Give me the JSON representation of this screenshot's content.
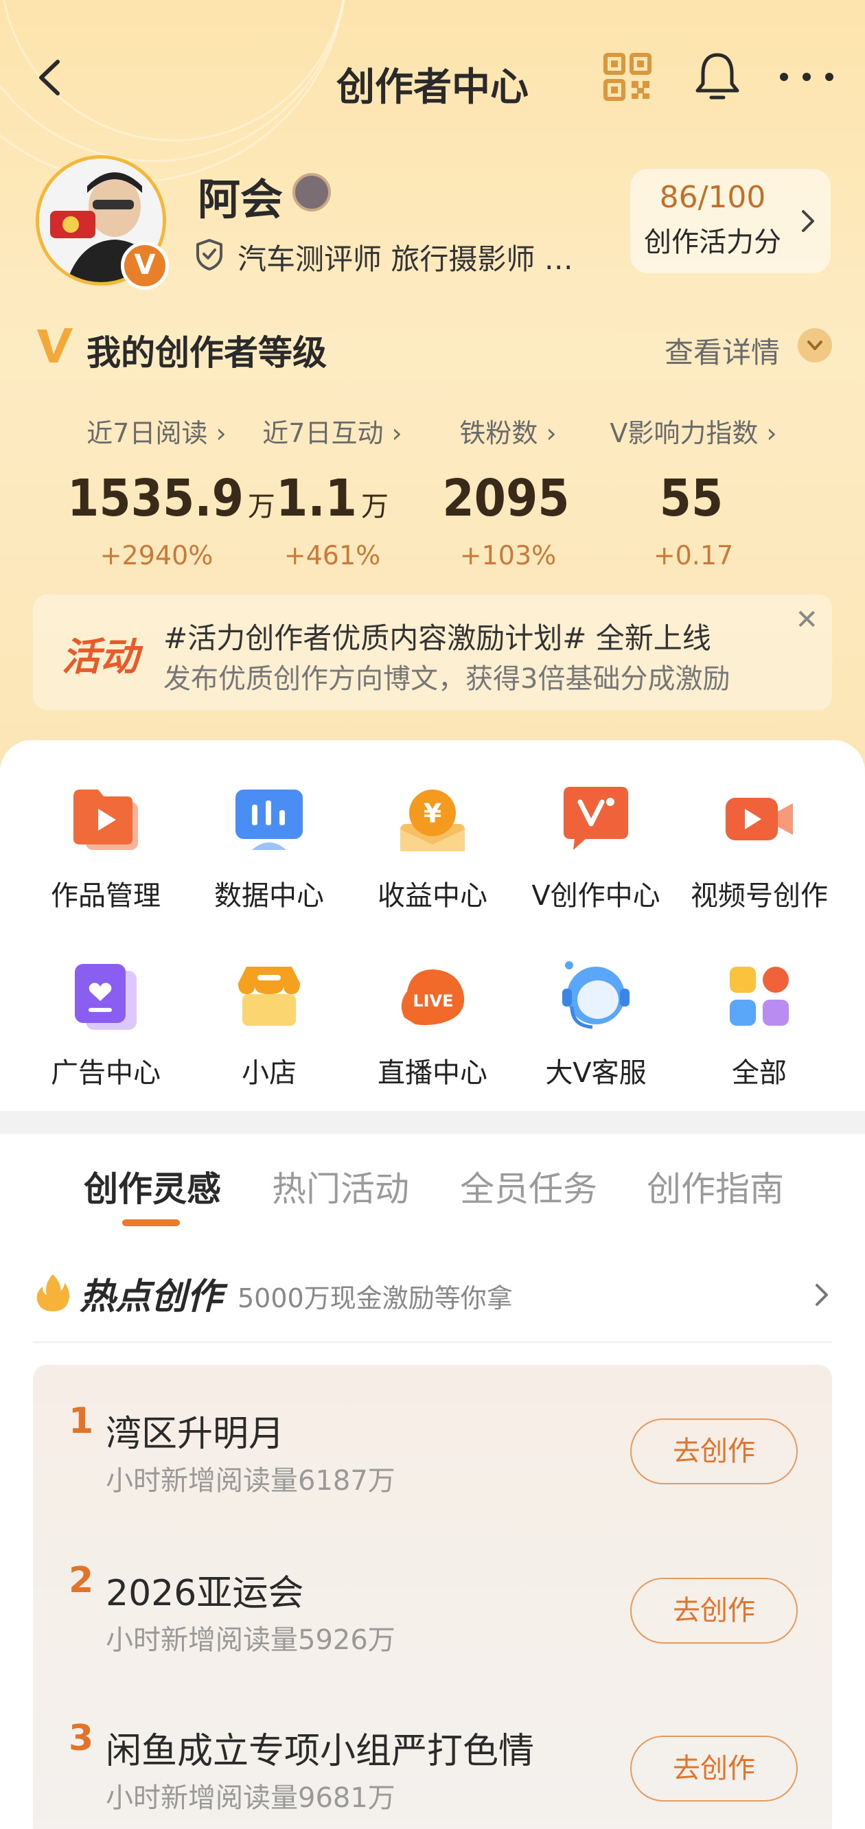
{
  "header": {
    "title": "创作者中心"
  },
  "profile": {
    "name": "阿会",
    "certification": "汽车测评师 旅行摄影师 …",
    "score": "86/100",
    "score_label": "创作活力分"
  },
  "level": {
    "title": "我的创作者等级",
    "detail_label": "查看详情",
    "stats": [
      {
        "label": "近7日阅读 ›",
        "value": "1535.9",
        "unit": "万",
        "change": "+2940%"
      },
      {
        "label": "近7日互动 ›",
        "value": "1.1",
        "unit": "万",
        "change": "+461%"
      },
      {
        "label": "铁粉数 ›",
        "value": "2095",
        "unit": "",
        "change": "+103%"
      },
      {
        "label": "V影响力指数 ›",
        "value": "55",
        "unit": "",
        "change": "+0.17"
      }
    ]
  },
  "banner": {
    "tag": "活动",
    "line1": "#活力创作者优质内容激励计划# 全新上线",
    "line2": "发布优质创作方向博文，获得3倍基础分成激励",
    "close": "✕"
  },
  "tools": [
    {
      "label": "作品管理",
      "icon": "works-icon"
    },
    {
      "label": "数据中心",
      "icon": "data-icon"
    },
    {
      "label": "收益中心",
      "icon": "income-icon"
    },
    {
      "label": "V创作中心",
      "icon": "v-create-icon"
    },
    {
      "label": "视频号创作",
      "icon": "video-icon"
    },
    {
      "label": "广告中心",
      "icon": "ad-icon"
    },
    {
      "label": "小店",
      "icon": "shop-icon"
    },
    {
      "label": "直播中心",
      "icon": "live-icon"
    },
    {
      "label": "大V客服",
      "icon": "service-icon"
    },
    {
      "label": "全部",
      "icon": "all-icon"
    }
  ],
  "tabs": [
    "创作灵感",
    "热门活动",
    "全员任务",
    "创作指南"
  ],
  "hot": {
    "title": "热点创作",
    "subtitle": "5000万现金激励等你拿",
    "items": [
      {
        "rank": "1",
        "name": "湾区升明月",
        "meta": "小时新增阅读量6187万",
        "button": "去创作"
      },
      {
        "rank": "2",
        "name": "2026亚运会",
        "meta": "小时新增阅读量5926万",
        "button": "去创作"
      },
      {
        "rank": "3",
        "name": "闲鱼成立专项小组严打色情",
        "meta": "小时新增阅读量9681万",
        "button": "去创作"
      }
    ]
  },
  "colors": {
    "accent": "#e0742a",
    "header_bg": "#fde4ad"
  }
}
